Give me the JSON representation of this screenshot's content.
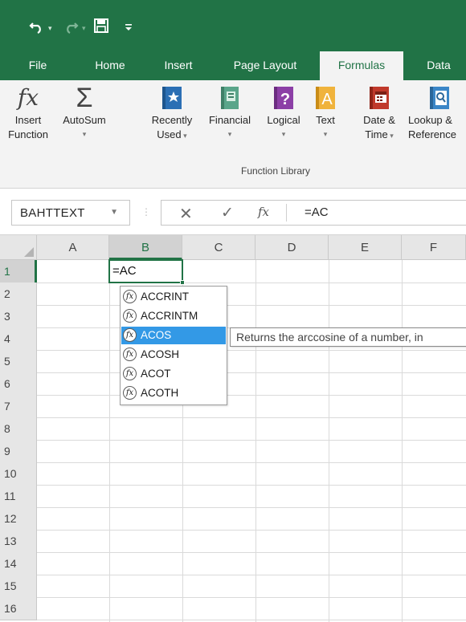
{
  "qat": {
    "undo_icon": "undo-icon",
    "redo_icon": "redo-icon",
    "save_icon": "save-icon",
    "customize_icon": "customize-qat-icon"
  },
  "tabs": [
    {
      "label": "File"
    },
    {
      "label": "Home"
    },
    {
      "label": "Insert"
    },
    {
      "label": "Page Layout"
    },
    {
      "label": "Formulas",
      "active": true
    },
    {
      "label": "Data"
    }
  ],
  "ribbon": {
    "insert_function": {
      "line1": "Insert",
      "line2": "Function",
      "glyph": "fx"
    },
    "autosum": {
      "line1": "AutoSum",
      "glyph": "Σ"
    },
    "recently_used": {
      "line1": "Recently",
      "line2": "Used"
    },
    "financial": {
      "line1": "Financial"
    },
    "logical": {
      "line1": "Logical",
      "glyph": "?"
    },
    "text": {
      "line1": "Text",
      "glyph": "A"
    },
    "date_time": {
      "line1": "Date &",
      "line2": "Time"
    },
    "lookup": {
      "line1": "Lookup &",
      "line2": "Reference"
    },
    "group_label": "Function Library"
  },
  "formula_bar": {
    "name_box": "BAHTTEXT",
    "cancel_glyph": "✕",
    "enter_glyph": "✓",
    "fx_glyph": "fx",
    "formula": "=AC"
  },
  "sheet": {
    "columns": [
      "A",
      "B",
      "C",
      "D",
      "E",
      "F"
    ],
    "rows": [
      "1",
      "2",
      "3",
      "4",
      "5",
      "6",
      "7",
      "8",
      "9",
      "10",
      "11",
      "12",
      "13",
      "14",
      "15",
      "16"
    ],
    "active_cell": {
      "ref": "B1",
      "value": "=AC"
    }
  },
  "autocomplete": {
    "items": [
      "ACCRINT",
      "ACCRINTM",
      "ACOS",
      "ACOSH",
      "ACOT",
      "ACOTH"
    ],
    "selected": "ACOS",
    "tooltip": "Returns the arccosine of a number, in"
  },
  "colors": {
    "accent": "#217346",
    "highlight": "#3399e6",
    "ribbon_bg": "#f3f3f3"
  }
}
